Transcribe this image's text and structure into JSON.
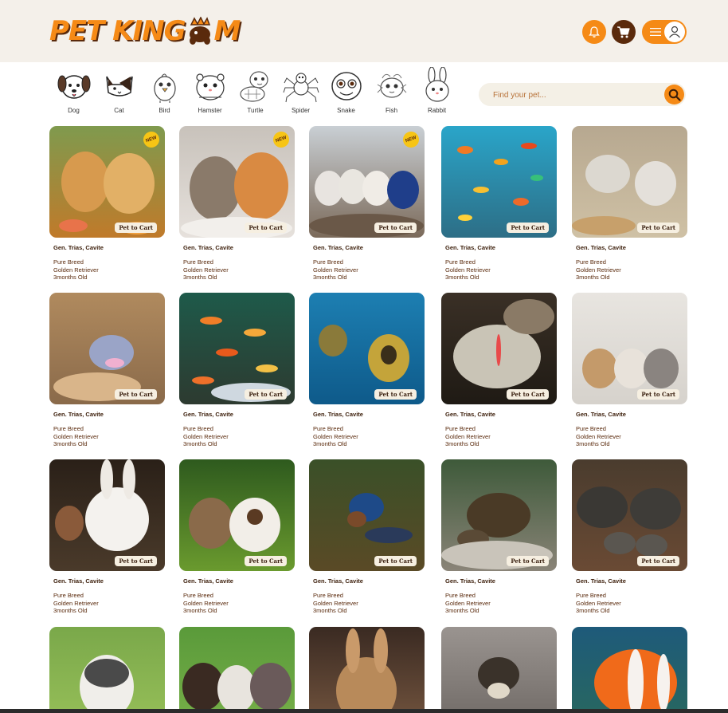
{
  "header": {
    "logo_left": "PET KING",
    "logo_right": "M"
  },
  "icons": {
    "bell": "bell-icon",
    "cart": "cart-icon",
    "menu": "menu-icon",
    "user": "user-icon",
    "search": "search-icon"
  },
  "colors": {
    "brand_orange": "#f58a16",
    "brand_brown": "#5a2a0c",
    "header_bg": "#f4f0ea",
    "new_badge": "#f7c515"
  },
  "categories": [
    {
      "label": "Dog"
    },
    {
      "label": "Cat"
    },
    {
      "label": "Bird"
    },
    {
      "label": "Hamster"
    },
    {
      "label": "Turtle"
    },
    {
      "label": "Spider"
    },
    {
      "label": "Snake"
    },
    {
      "label": "Fish"
    },
    {
      "label": "Rabbit"
    }
  ],
  "search": {
    "placeholder": "Find your pet..."
  },
  "cards": [
    {
      "image": "puppies",
      "new": "NEW",
      "add": "Pet to Cart",
      "location": "Gen. Trias, Cavite",
      "breed": "Pure Breed",
      "kind": "Golden Retriever",
      "age": "3months Old"
    },
    {
      "image": "kittens",
      "new": "NEW",
      "add": "Pet to Cart",
      "location": "Gen. Trias, Cavite",
      "breed": "Pure Breed",
      "kind": "Golden Retriever",
      "age": "3months Old"
    },
    {
      "image": "birds",
      "new": "NEW",
      "add": "Pet to Cart",
      "location": "Gen. Trias, Cavite",
      "breed": "Pure Breed",
      "kind": "Golden Retriever",
      "age": "3months Old"
    },
    {
      "image": "fish",
      "add": "Pet to Cart",
      "location": "Gen. Trias, Cavite",
      "breed": "Pure Breed",
      "kind": "Golden Retriever",
      "age": "3months Old"
    },
    {
      "image": "hamsters",
      "add": "Pet to Cart",
      "location": "Gen. Trias, Cavite",
      "breed": "Pure Breed",
      "kind": "Golden Retriever",
      "age": "3months Old"
    },
    {
      "image": "jumping-spider",
      "add": "Pet to Cart",
      "location": "Gen. Trias, Cavite",
      "breed": "Pure Breed",
      "kind": "Golden Retriever",
      "age": "3months Old"
    },
    {
      "image": "aquarium",
      "add": "Pet to Cart",
      "location": "Gen. Trias, Cavite",
      "breed": "Pure Breed",
      "kind": "Golden Retriever",
      "age": "3months Old"
    },
    {
      "image": "turtles-water",
      "add": "Pet to Cart",
      "location": "Gen. Trias, Cavite",
      "breed": "Pure Breed",
      "kind": "Golden Retriever",
      "age": "3months Old"
    },
    {
      "image": "snake",
      "add": "Pet to Cart",
      "location": "Gen. Trias, Cavite",
      "breed": "Pure Breed",
      "kind": "Golden Retriever",
      "age": "3months Old"
    },
    {
      "image": "rabbits",
      "add": "Pet to Cart",
      "location": "Gen. Trias, Cavite",
      "breed": "Pure Breed",
      "kind": "Golden Retriever",
      "age": "3months Old"
    },
    {
      "image": "white-rabbit",
      "add": "Pet to Cart",
      "location": "Gen. Trias, Cavite",
      "breed": "Pure Breed",
      "kind": "Golden Retriever",
      "age": "3months Old"
    },
    {
      "image": "bunnies-grass",
      "add": "Pet to Cart",
      "location": "Gen. Trias, Cavite",
      "breed": "Pure Breed",
      "kind": "Golden Retriever",
      "age": "3months Old"
    },
    {
      "image": "tarantula",
      "add": "Pet to Cart",
      "location": "Gen. Trias, Cavite",
      "breed": "Pure Breed",
      "kind": "Golden Retriever",
      "age": "3months Old"
    },
    {
      "image": "tortoise",
      "add": "Pet to Cart",
      "location": "Gen. Trias, Cavite",
      "breed": "Pure Breed",
      "kind": "Golden Retriever",
      "age": "3months Old"
    },
    {
      "image": "turtles-pair",
      "add": "Pet to Cart",
      "location": "Gen. Trias, Cavite",
      "breed": "Pure Breed",
      "kind": "Golden Retriever",
      "age": "3months Old"
    },
    {
      "image": "husky-puppy"
    },
    {
      "image": "aussie-puppies"
    },
    {
      "image": "brown-rabbit"
    },
    {
      "image": "spider"
    },
    {
      "image": "clownfish"
    }
  ]
}
